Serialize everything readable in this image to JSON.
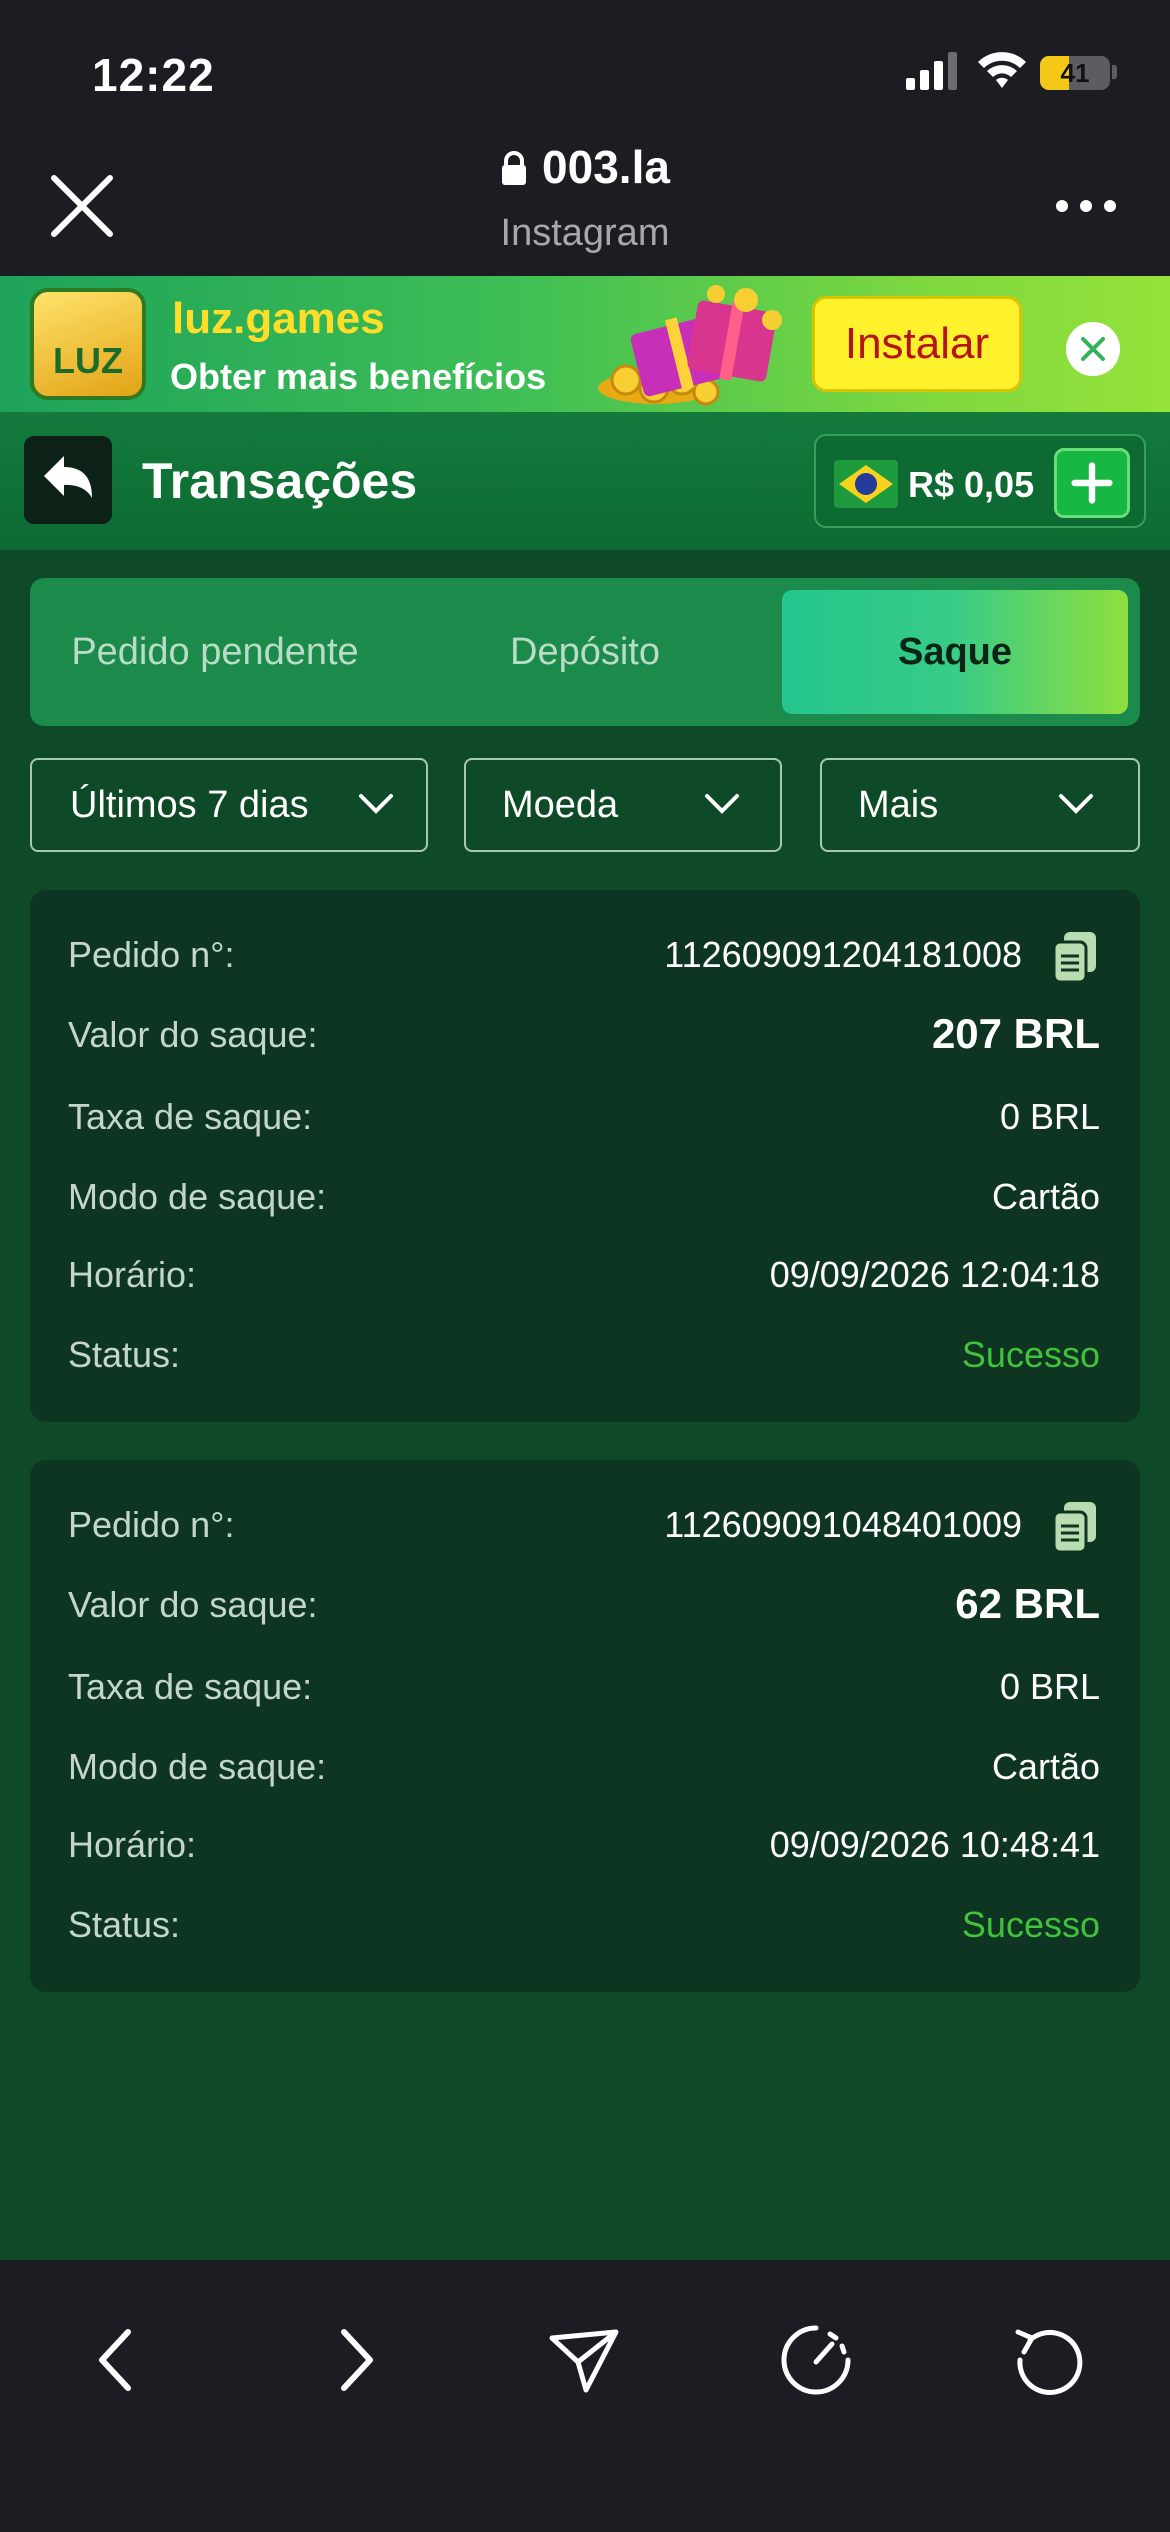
{
  "status_bar": {
    "time": "12:22",
    "battery_level": "41",
    "battery_fraction": 0.41
  },
  "browser": {
    "url": "003.la",
    "subtitle": "Instagram"
  },
  "banner": {
    "title": "luz.games",
    "subtitle": "Obter mais benefícios",
    "install_label": "Instalar",
    "logo_text": "LUZ"
  },
  "header": {
    "title": "Transações",
    "balance": "R$ 0,05"
  },
  "tabs": [
    {
      "label": "Pedido pendente",
      "active": false
    },
    {
      "label": "Depósito",
      "active": false
    },
    {
      "label": "Saque",
      "active": true
    }
  ],
  "filters": {
    "period": "Últimos 7 dias",
    "currency": "Moeda",
    "more": "Mais"
  },
  "labels": {
    "order": "Pedido n°:",
    "amount": "Valor do saque:",
    "fee": "Taxa de saque:",
    "mode": "Modo de saque:",
    "time": "Horário:",
    "status": "Status:"
  },
  "transactions": [
    {
      "order_id": "112609091204181008",
      "amount": "207 BRL",
      "fee": "0 BRL",
      "mode": "Cartão",
      "time": "09/09/2026 12:04:18",
      "status": "Sucesso"
    },
    {
      "order_id": "112609091048401009",
      "amount": "62 BRL",
      "fee": "0 BRL",
      "mode": "Cartão",
      "time": "09/09/2026 10:48:41",
      "status": "Sucesso"
    }
  ],
  "colors": {
    "background": "#0f4a28",
    "success": "#41c23a",
    "accent": "#24c58e",
    "banner_yellow": "#fff22c"
  }
}
